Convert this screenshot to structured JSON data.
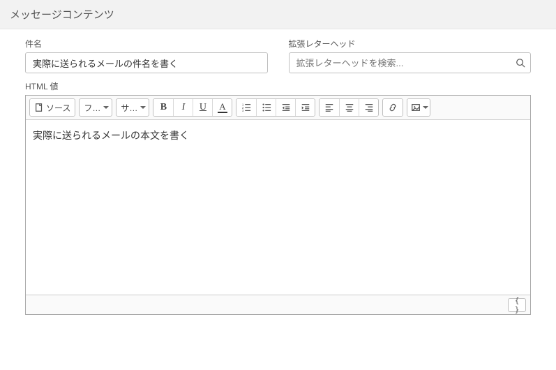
{
  "section": {
    "title": "メッセージコンテンツ"
  },
  "fields": {
    "subject": {
      "label": "件名",
      "value": "実際に送られるメールの件名を書く"
    },
    "letterhead": {
      "label": "拡張レターヘッド",
      "placeholder": "拡張レターヘッドを検索..."
    },
    "html_value": {
      "label": "HTML 値",
      "body": "実際に送られるメールの本文を書く"
    }
  },
  "toolbar": {
    "source": "ソース",
    "format_combo": "フォーマット",
    "size_combo": "サイズ",
    "footer_code": "{ }"
  }
}
